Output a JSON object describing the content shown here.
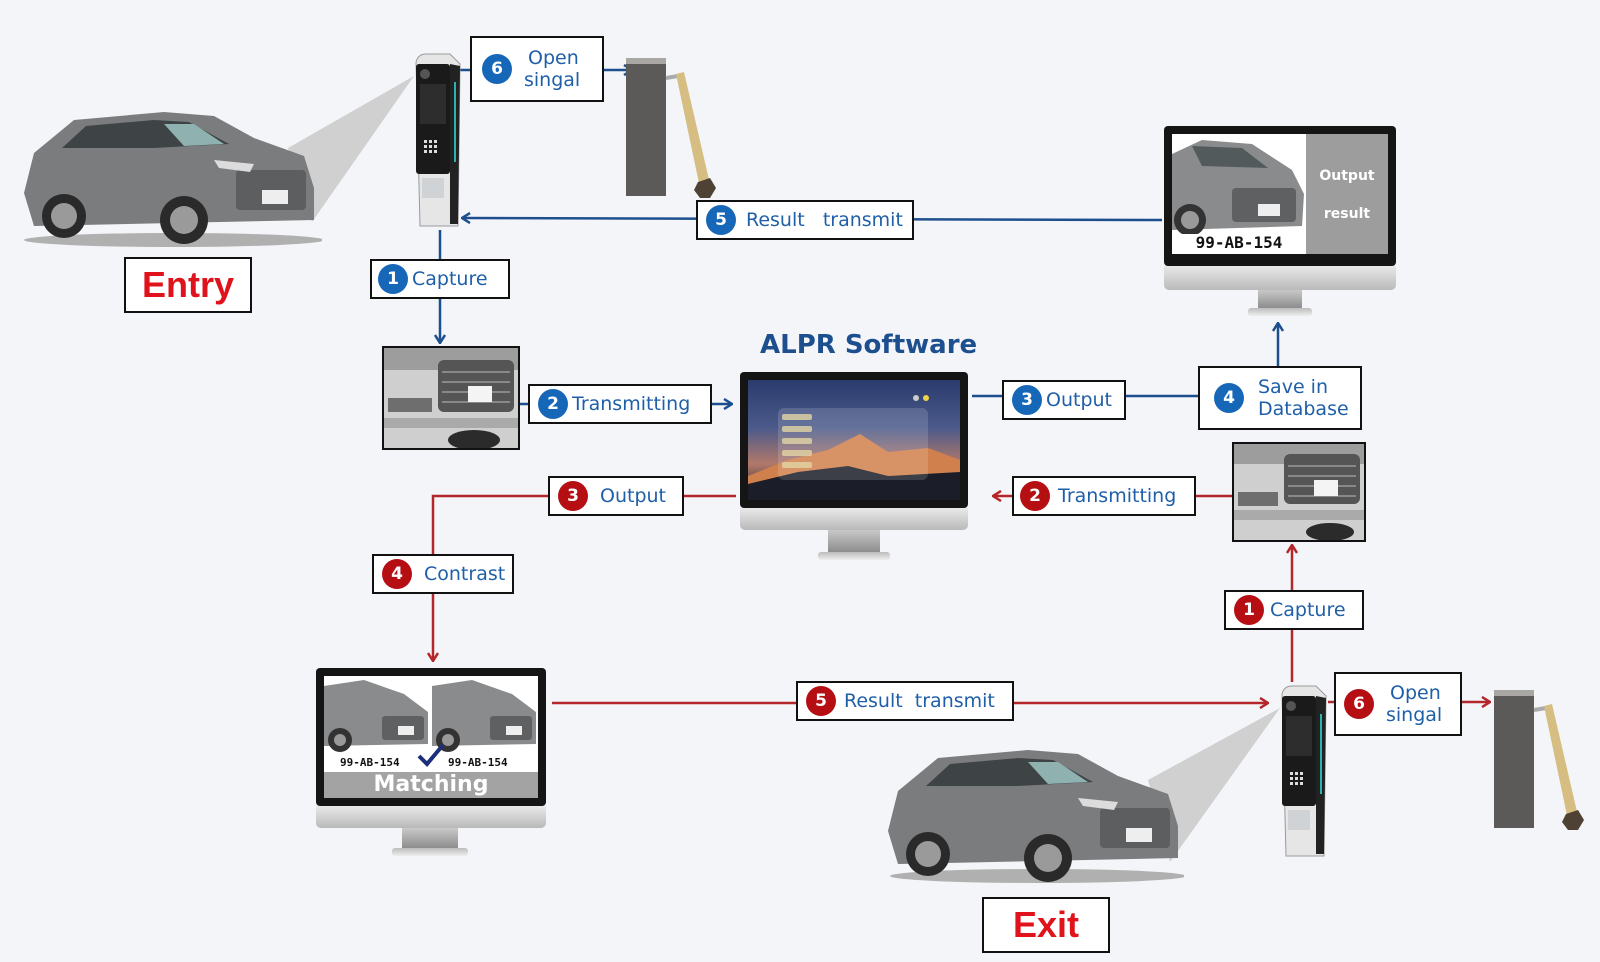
{
  "diagram": {
    "title": "ALPR Software",
    "colors": {
      "entry_flow": "#1d4f8f",
      "exit_flow": "#b5262b",
      "label_text": "#1f5fa8",
      "heading_red": "#e0121b"
    },
    "entry": {
      "heading": "Entry",
      "steps": [
        {
          "num": "1",
          "label": "Capture"
        },
        {
          "num": "2",
          "label": "Transmitting"
        },
        {
          "num": "3",
          "label": "Output"
        },
        {
          "num": "4",
          "label_line1": "Save in",
          "label_line2": "Database"
        },
        {
          "num": "5",
          "label": "Result   transmit"
        },
        {
          "num": "6",
          "label_line1": "Open",
          "label_line2": "singal"
        }
      ],
      "output_monitor": {
        "plate": "99-AB-154",
        "panel_line1": "Output",
        "panel_line2": "result"
      }
    },
    "exit": {
      "heading": "Exit",
      "steps": [
        {
          "num": "1",
          "label": "Capture"
        },
        {
          "num": "2",
          "label": "Transmitting"
        },
        {
          "num": "3",
          "label": "Output"
        },
        {
          "num": "4",
          "label": "Contrast"
        },
        {
          "num": "5",
          "label": "Result  transmit"
        },
        {
          "num": "6",
          "label_line1": "Open",
          "label_line2": "singal"
        }
      ],
      "matching_monitor": {
        "plate_left": "99-AB-154",
        "plate_right": "99-AB-154",
        "caption": "Matching"
      }
    },
    "icons": [
      "car-icon",
      "lpr-camera-kiosk-icon",
      "barrier-gate-icon",
      "monitor-icon",
      "checkmark-icon",
      "arrow-icon"
    ]
  }
}
